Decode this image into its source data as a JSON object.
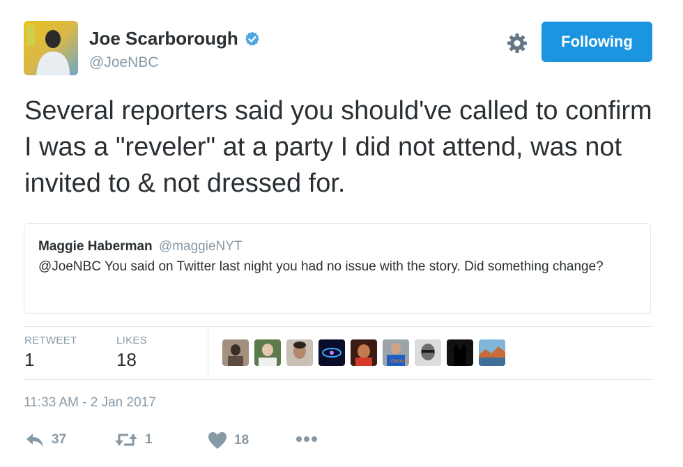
{
  "author": {
    "name": "Joe Scarborough",
    "handle": "@JoeNBC",
    "verified": true,
    "avatar_icon": "profile-photo"
  },
  "header": {
    "follow_label": "Following",
    "gear_icon": "gear-icon"
  },
  "tweet": {
    "text": "Several reporters said you should've called to confirm I was a \"reveler\" at a party I did not attend, was not invited to & not dressed for."
  },
  "quote": {
    "name": "Maggie Haberman",
    "handle": "@maggieNYT",
    "text": "@JoeNBC You said on Twitter last night you had no issue with the story. Did something change?"
  },
  "stats": {
    "retweet_label": "RETWEET",
    "retweet_count": "1",
    "likes_label": "LIKES",
    "likes_count": "18"
  },
  "likers_count_shown": 9,
  "timestamp": "11:33 AM - 2 Jan 2017",
  "actions": {
    "reply_count": "37",
    "retweet_count": "1",
    "like_count": "18"
  },
  "colors": {
    "accent": "#1b95e0",
    "muted": "#8899a6",
    "text": "#292f33",
    "border": "#e1e8ed"
  }
}
